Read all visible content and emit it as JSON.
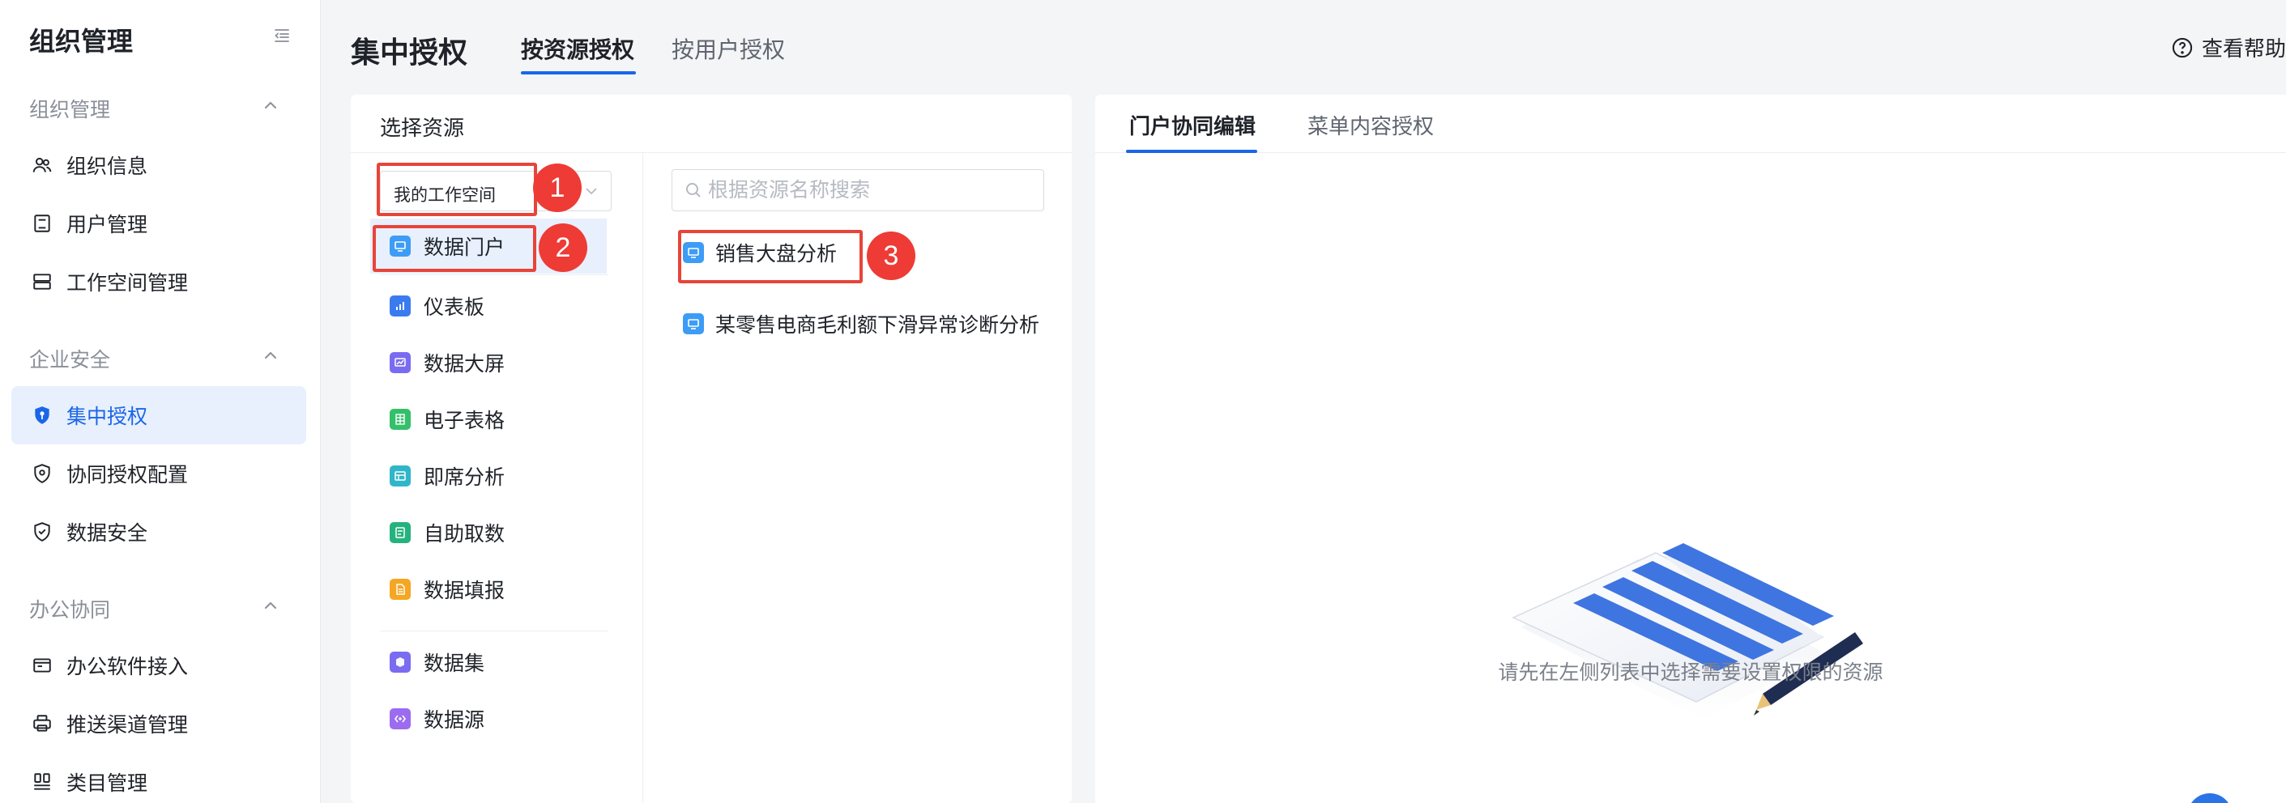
{
  "sidebar": {
    "title": "组织管理",
    "groups": [
      {
        "label": "组织管理",
        "items": [
          "组织信息",
          "用户管理",
          "工作空间管理"
        ]
      },
      {
        "label": "企业安全",
        "items": [
          "集中授权",
          "协同授权配置",
          "数据安全"
        ]
      },
      {
        "label": "办公协同",
        "items": [
          "办公软件接入",
          "推送渠道管理",
          "类目管理"
        ]
      }
    ],
    "active_item": "集中授权",
    "icons": {
      "collapse": "menu-fold-icon",
      "组织信息": "org-users-icon",
      "用户管理": "user-card-icon",
      "工作空间管理": "workspace-icon",
      "集中授权": "shield-key-icon",
      "协同授权配置": "shield-gear-icon",
      "数据安全": "shield-check-icon",
      "办公软件接入": "app-window-icon",
      "推送渠道管理": "push-printer-icon",
      "类目管理": "category-icon"
    }
  },
  "header": {
    "title": "集中授权",
    "tabs": [
      {
        "label": "按资源授权",
        "active": true
      },
      {
        "label": "按用户授权",
        "active": false
      }
    ],
    "help_label": "查看帮助"
  },
  "left_panel": {
    "title": "选择资源",
    "workspace_select": {
      "value": "我的工作空间"
    },
    "resource_types": [
      {
        "label": "数据门户",
        "icon": "portal-icon",
        "color": "#3d9cf5",
        "selected": true
      },
      {
        "label": "仪表板",
        "icon": "dashboard-icon",
        "color": "#3b7bf0",
        "selected": false
      },
      {
        "label": "数据大屏",
        "icon": "screen-icon",
        "color": "#7a6cf0",
        "selected": false
      },
      {
        "label": "电子表格",
        "icon": "spreadsheet-icon",
        "color": "#34c06a",
        "selected": false
      },
      {
        "label": "即席分析",
        "icon": "adhoc-analysis-icon",
        "color": "#2fb6c9",
        "selected": false
      },
      {
        "label": "自助取数",
        "icon": "self-fetch-icon",
        "color": "#26b27e",
        "selected": false
      },
      {
        "label": "数据填报",
        "icon": "data-form-icon",
        "color": "#f5a623",
        "selected": false
      },
      {
        "label": "数据集",
        "icon": "dataset-icon",
        "color": "#7a6cf0",
        "selected": false
      },
      {
        "label": "数据源",
        "icon": "datasource-icon",
        "color": "#9b6cf0",
        "selected": false
      }
    ],
    "search": {
      "placeholder": "根据资源名称搜索",
      "value": ""
    },
    "results": [
      {
        "label": "销售大盘分析",
        "icon": "portal-icon"
      },
      {
        "label": "某零售电商毛利额下滑异常诊断分析",
        "icon": "portal-icon"
      }
    ]
  },
  "annotations": [
    "1",
    "2",
    "3"
  ],
  "right_panel": {
    "tabs": [
      {
        "label": "门户协同编辑",
        "active": true
      },
      {
        "label": "菜单内容授权",
        "active": false
      }
    ],
    "empty_text": "请先在左侧列表中选择需要设置权限的资源",
    "empty_icon": "document-pencil-illustration"
  },
  "colors": {
    "accent": "#1b66e8",
    "active_bg": "#e8f0fd",
    "annotation_red": "#ee3b36"
  }
}
